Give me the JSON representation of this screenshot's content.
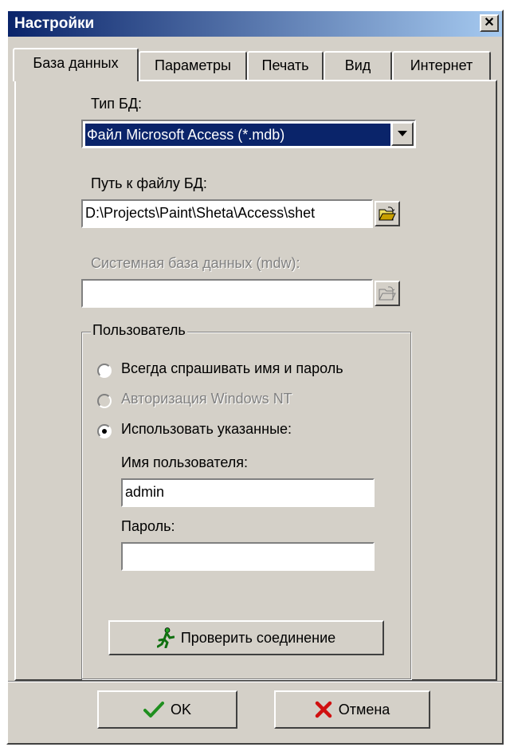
{
  "window": {
    "title": "Настройки"
  },
  "tabs": [
    {
      "label": "База данных",
      "active": true
    },
    {
      "label": "Параметры"
    },
    {
      "label": "Печать"
    },
    {
      "label": "Вид"
    },
    {
      "label": "Интернет"
    }
  ],
  "db": {
    "type_label": "Тип БД:",
    "type_value": "Файл Microsoft Access (*.mdb)",
    "path_label": "Путь к файлу БД:",
    "path_value": "D:\\Projects\\Paint\\Sheta\\Access\\shet",
    "system_label": "Системная база данных (mdw):",
    "system_value": ""
  },
  "user_group": {
    "title": "Пользователь",
    "options": [
      {
        "label": "Всегда спрашивать имя и пароль",
        "selected": false,
        "enabled": true
      },
      {
        "label": "Авторизация Windows NT",
        "selected": false,
        "enabled": false
      },
      {
        "label": "Использовать указанные:",
        "selected": true,
        "enabled": true
      }
    ],
    "username_label": "Имя пользователя:",
    "username_value": "admin",
    "password_label": "Пароль:",
    "password_value": ""
  },
  "buttons": {
    "test_connection": "Проверить соединение",
    "ok": "OK",
    "cancel": "Отмена"
  },
  "colors": {
    "titlebar": "#0a246a",
    "face": "#d4d0c8",
    "selection": "#0a246a"
  }
}
